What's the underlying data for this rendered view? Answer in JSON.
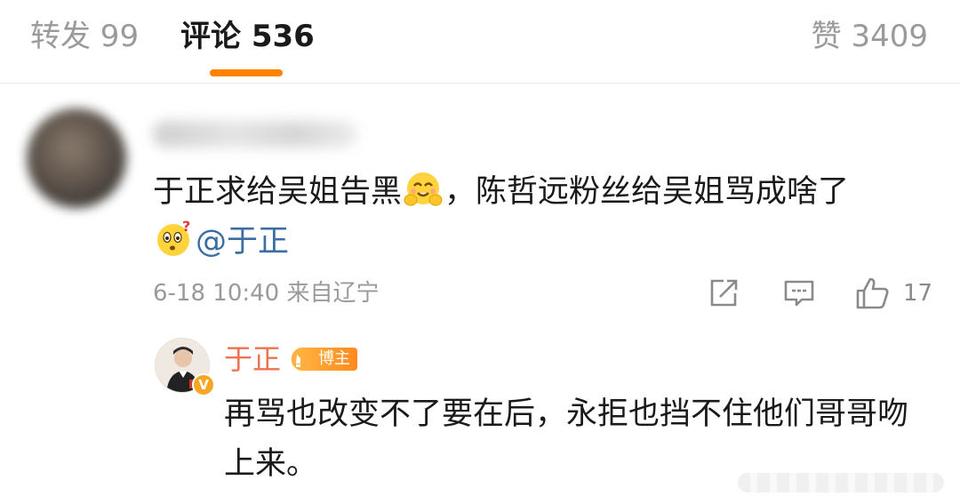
{
  "tabs": {
    "repost": "转发 99",
    "comment": "评论 536",
    "like": "赞 3409",
    "accent": "#ff8200"
  },
  "comment": {
    "avatar": "blurred-avatar",
    "username": "blurred-username",
    "text_before_emoji": "于正求给吴姐告黑",
    "emoji_1": "hug-emoji",
    "text_after_emoji": "，陈哲远粉丝给吴姐骂成啥了",
    "emoji_2": "confused-emoji",
    "mention": "@于正",
    "time": "6-18 10:40",
    "location": "来自辽宁",
    "like_count": "17",
    "icons": [
      "share-icon",
      "reply-icon",
      "thumb-up-icon"
    ]
  },
  "reply": {
    "name": "于正",
    "name_color": "#eb7350",
    "badge": "博主",
    "verified_mark": "V",
    "text": "再骂也改变不了要在后，永拒也挡不住他们哥哥吻上来。"
  }
}
